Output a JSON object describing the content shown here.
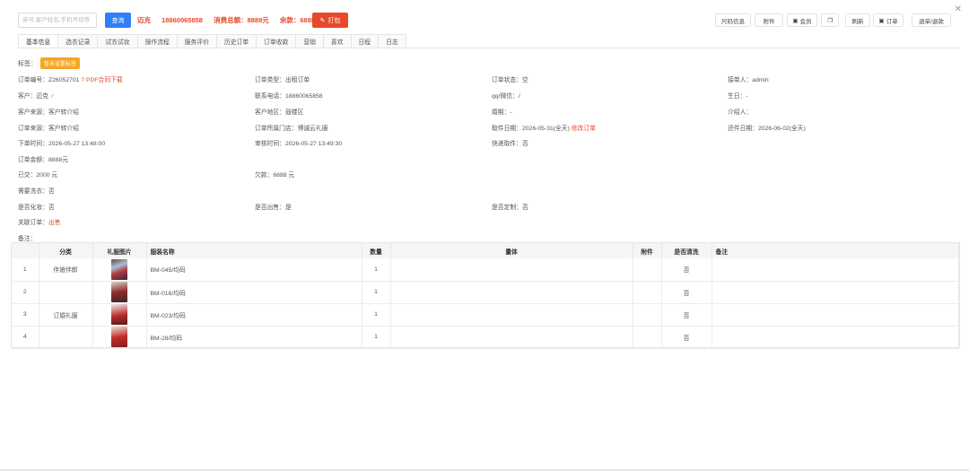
{
  "toolbar": {
    "search_placeholder": "单号,客户姓名,手机号码等",
    "query_label": "查询",
    "customer_name": "迈克",
    "customer_phone": "18860065858",
    "total_spent": "消费总额：8888元",
    "balance": "余款：6888",
    "print_label": "打包",
    "buttons": [
      "尺码信息",
      "附件",
      "会员",
      "",
      "刷新",
      "订单",
      "退单/退款"
    ],
    "close_icon": "close-icon"
  },
  "tabs": [
    "基本信息",
    "选衣记录",
    "试衣试妆",
    "操作流程",
    "服务评价",
    "历史订单",
    "订单收款",
    "营销",
    "喜欢",
    "日程",
    "日志"
  ],
  "tag": {
    "label": "标签：",
    "value": "暂未设置标签"
  },
  "fields": {
    "order_no": "订单编号：Z26052701",
    "pdf_link": "PDF合同下载",
    "order_type": "订单类型：出租订单",
    "order_status": "订单状态：空",
    "receiver": "接单人：admin",
    "customer_label": "客户：迈克",
    "phone": "联系电话：18860065858",
    "qq_wechat": "qq/微信：/",
    "birthday": "生日：-",
    "customer_source": "客户来源：客户转介绍",
    "customer_area": "客户地区：鼓楼区",
    "wedding_date": "婚期：-",
    "referrer": "介绍人：",
    "order_source": "订单来源：客户转介绍",
    "store": "订单所属门店：博诚云礼服",
    "pickup_date": "取件日期：2026-05-31(全天)",
    "modify_order": "修改订单",
    "return_date": "还件日期：2026-06-02(全天)",
    "order_time": "下单时间：2026-05-27 13:48:00",
    "review_time": "审核时间：2026-05-27 13:49:30",
    "express": "快递取件：否",
    "order_amount": "订单金额：8888元",
    "paid": "已交：2000 元",
    "owed": "欠款：6888 元",
    "need_wash": "需要洗衣：否",
    "makeup": "是否化妆：否",
    "sell": "是否出售：是",
    "custom": "是否定制：否",
    "related_order_label": "关联订单：",
    "related_order_value": "出售",
    "remark": "备注："
  },
  "table": {
    "headers": [
      "",
      "分类",
      "礼服图片",
      "服装名称",
      "数量",
      "量体",
      "附件",
      "是否清洗",
      "备注"
    ],
    "rows": [
      {
        "no": "1",
        "category": "伴娘伴郎",
        "name": "BM-045/均码",
        "qty": "1",
        "wash": "否"
      },
      {
        "no": "2",
        "category": "",
        "name": "BM-016/均码",
        "qty": "1",
        "wash": "否"
      },
      {
        "no": "3",
        "category": "订婚礼服",
        "name": "BM-023/均码",
        "qty": "1",
        "wash": "否"
      },
      {
        "no": "4",
        "category": "",
        "name": "BM-28/均码",
        "qty": "1",
        "wash": "否"
      }
    ]
  }
}
